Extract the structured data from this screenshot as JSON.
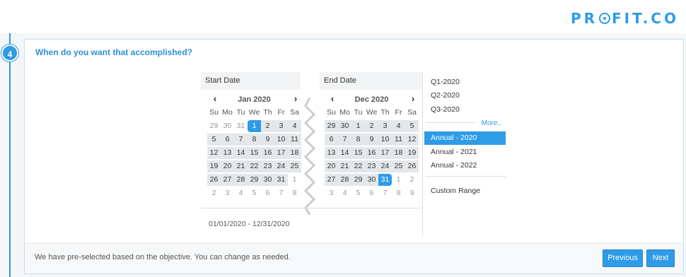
{
  "brand": {
    "logo_left": "PR",
    "logo_right": "FIT.CO"
  },
  "step": {
    "number": "4",
    "question": "When do you want that accomplished?"
  },
  "picker": {
    "start_label": "Start Date",
    "end_label": "End Date",
    "weekdays": [
      "Su",
      "Mo",
      "Tu",
      "We",
      "Th",
      "Fr",
      "Sa"
    ],
    "prev_glyph": "‹",
    "next_glyph": "›",
    "left_month": {
      "name": "Jan 2020",
      "days": [
        {
          "d": "29",
          "state": "off"
        },
        {
          "d": "30",
          "state": "off"
        },
        {
          "d": "31",
          "state": "off"
        },
        {
          "d": "1",
          "state": "start"
        },
        {
          "d": "2",
          "state": "in"
        },
        {
          "d": "3",
          "state": "in"
        },
        {
          "d": "4",
          "state": "in"
        },
        {
          "d": "5",
          "state": "in"
        },
        {
          "d": "6",
          "state": "in"
        },
        {
          "d": "7",
          "state": "in"
        },
        {
          "d": "8",
          "state": "in"
        },
        {
          "d": "9",
          "state": "in"
        },
        {
          "d": "10",
          "state": "in"
        },
        {
          "d": "11",
          "state": "in"
        },
        {
          "d": "12",
          "state": "in"
        },
        {
          "d": "13",
          "state": "in"
        },
        {
          "d": "14",
          "state": "in"
        },
        {
          "d": "15",
          "state": "in"
        },
        {
          "d": "16",
          "state": "in"
        },
        {
          "d": "17",
          "state": "in"
        },
        {
          "d": "18",
          "state": "in"
        },
        {
          "d": "19",
          "state": "in"
        },
        {
          "d": "20",
          "state": "in"
        },
        {
          "d": "21",
          "state": "in"
        },
        {
          "d": "22",
          "state": "in"
        },
        {
          "d": "23",
          "state": "in"
        },
        {
          "d": "24",
          "state": "in"
        },
        {
          "d": "25",
          "state": "in"
        },
        {
          "d": "26",
          "state": "in"
        },
        {
          "d": "27",
          "state": "in"
        },
        {
          "d": "28",
          "state": "in"
        },
        {
          "d": "29",
          "state": "in"
        },
        {
          "d": "30",
          "state": "in"
        },
        {
          "d": "31",
          "state": "in"
        },
        {
          "d": "1",
          "state": "off"
        },
        {
          "d": "2",
          "state": "off"
        },
        {
          "d": "3",
          "state": "off"
        },
        {
          "d": "4",
          "state": "off"
        },
        {
          "d": "5",
          "state": "off"
        },
        {
          "d": "6",
          "state": "off"
        },
        {
          "d": "7",
          "state": "off"
        },
        {
          "d": "8",
          "state": "off"
        }
      ]
    },
    "right_month": {
      "name": "Dec 2020",
      "days": [
        {
          "d": "29",
          "state": "in"
        },
        {
          "d": "30",
          "state": "in"
        },
        {
          "d": "1",
          "state": "in"
        },
        {
          "d": "2",
          "state": "in"
        },
        {
          "d": "3",
          "state": "in"
        },
        {
          "d": "4",
          "state": "in"
        },
        {
          "d": "5",
          "state": "in"
        },
        {
          "d": "6",
          "state": "in"
        },
        {
          "d": "7",
          "state": "in"
        },
        {
          "d": "8",
          "state": "in"
        },
        {
          "d": "9",
          "state": "in"
        },
        {
          "d": "10",
          "state": "in"
        },
        {
          "d": "11",
          "state": "in"
        },
        {
          "d": "12",
          "state": "in"
        },
        {
          "d": "13",
          "state": "in"
        },
        {
          "d": "14",
          "state": "in"
        },
        {
          "d": "15",
          "state": "in"
        },
        {
          "d": "16",
          "state": "in"
        },
        {
          "d": "17",
          "state": "in"
        },
        {
          "d": "18",
          "state": "in"
        },
        {
          "d": "19",
          "state": "in"
        },
        {
          "d": "20",
          "state": "in"
        },
        {
          "d": "21",
          "state": "in"
        },
        {
          "d": "22",
          "state": "in"
        },
        {
          "d": "23",
          "state": "in"
        },
        {
          "d": "24",
          "state": "in"
        },
        {
          "d": "25",
          "state": "in"
        },
        {
          "d": "26",
          "state": "in"
        },
        {
          "d": "27",
          "state": "in"
        },
        {
          "d": "28",
          "state": "in"
        },
        {
          "d": "29",
          "state": "in"
        },
        {
          "d": "30",
          "state": "in"
        },
        {
          "d": "31",
          "state": "end"
        },
        {
          "d": "1",
          "state": "off"
        },
        {
          "d": "2",
          "state": "off"
        },
        {
          "d": "3",
          "state": "off"
        },
        {
          "d": "4",
          "state": "off"
        },
        {
          "d": "5",
          "state": "off"
        },
        {
          "d": "6",
          "state": "off"
        },
        {
          "d": "7",
          "state": "off"
        },
        {
          "d": "8",
          "state": "off"
        },
        {
          "d": "9",
          "state": "off"
        }
      ]
    },
    "range_text": "01/01/2020 - 12/31/2020",
    "presets_top": [
      "Q1-2020",
      "Q2-2020",
      "Q3-2020"
    ],
    "more_label": "More..",
    "presets_annual": [
      "Annual - 2020",
      "Annual - 2021",
      "Annual - 2022"
    ],
    "active_preset": "Annual - 2020",
    "custom_label": "Custom Range"
  },
  "footer": {
    "note": "We have pre-selected based on the objective. You can change as needed.",
    "previous_label": "Previous",
    "next_label": "Next"
  },
  "colors": {
    "accent": "#2e9be6",
    "range_bg": "#e4e7ea"
  }
}
